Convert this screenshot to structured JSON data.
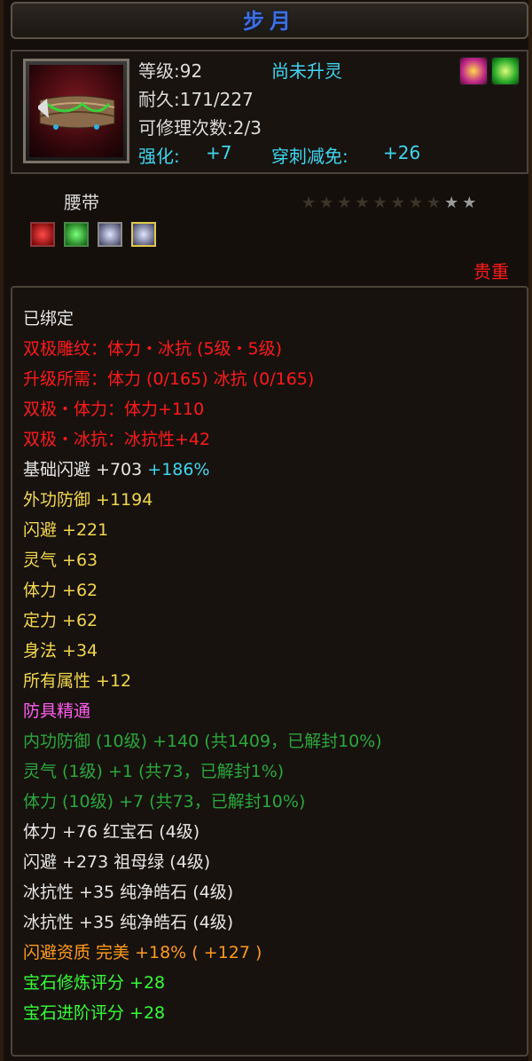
{
  "title": "步月",
  "header": {
    "level": "等级:92",
    "spirit": "尚未升灵",
    "durability": "耐久:171/227",
    "repair": "可修理次数:2/3",
    "enhance_label": "强化:",
    "enhance_value": "+7",
    "pierce_label": "穿刺减免:",
    "pierce_value": "+26"
  },
  "item_type": "腰带",
  "stars": {
    "filled": 8,
    "total": 10
  },
  "rarity": "贵重",
  "stats": [
    {
      "text": "已绑定",
      "color": "white"
    },
    {
      "text": "双极雕纹：体力・冰抗 (5级・5级)",
      "color": "red"
    },
    {
      "text": "升级所需：体力 (0/165)   冰抗 (0/165)",
      "color": "red"
    },
    {
      "text": "双极・体力：体力+110",
      "color": "red"
    },
    {
      "text": "双极・冰抗：冰抗性+42",
      "color": "red"
    },
    {
      "text": "基础闪避 +703",
      "extra": "+186%",
      "color": "white"
    },
    {
      "text": "外功防御 +1194",
      "color": "yellow"
    },
    {
      "text": "闪避 +221",
      "color": "yellow"
    },
    {
      "text": "灵气 +63",
      "color": "yellow"
    },
    {
      "text": "体力 +62",
      "color": "yellow"
    },
    {
      "text": "定力 +62",
      "color": "yellow"
    },
    {
      "text": "身法 +34",
      "color": "yellow"
    },
    {
      "text": "所有属性 +12",
      "color": "yellow"
    },
    {
      "text": "防具精通",
      "color": "pink"
    },
    {
      "text": "内功防御 (10级) +140 (共1409，已解封10%)",
      "color": "dgreen"
    },
    {
      "text": "灵气 (1级) +1 (共73，已解封1%)",
      "color": "dgreen"
    },
    {
      "text": "体力 (10级) +7 (共73，已解封10%)",
      "color": "dgreen"
    },
    {
      "text": "体力 +76  红宝石 (4级)",
      "color": "white"
    },
    {
      "text": "闪避 +273  祖母绿 (4级)",
      "color": "white"
    },
    {
      "text": "冰抗性 +35  纯净皓石 (4级)",
      "color": "white"
    },
    {
      "text": "冰抗性 +35  纯净皓石 (4级)",
      "color": "white"
    },
    {
      "text": "闪避资质   完美  +18% ( +127 )",
      "color": "orange"
    },
    {
      "text": "宝石修炼评分 +28",
      "color": "green"
    },
    {
      "text": "宝石进阶评分 +28",
      "color": "green"
    }
  ]
}
